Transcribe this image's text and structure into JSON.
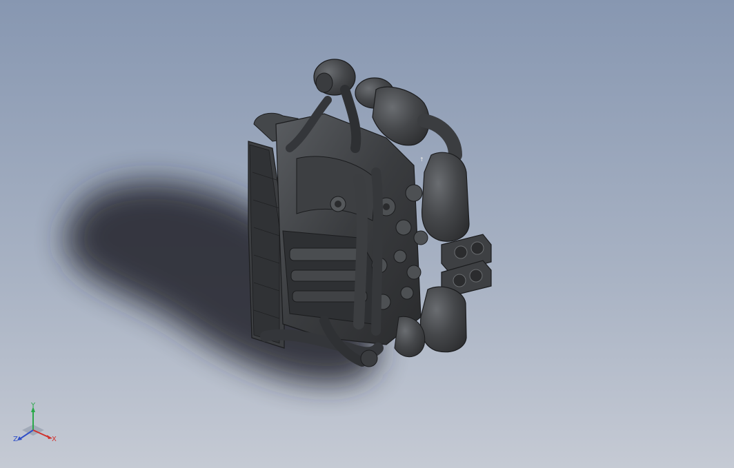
{
  "viewport": {
    "background_top": "#8797b1",
    "background_bottom": "#c2c8d3",
    "model_color": "#3b3d40",
    "shadow_color": "#1a1d22"
  },
  "triad": {
    "x_label": "X",
    "y_label": "Y",
    "z_label": "Z",
    "x_color": "#d0312d",
    "y_color": "#2aa84a",
    "z_color": "#2f4fc7"
  }
}
